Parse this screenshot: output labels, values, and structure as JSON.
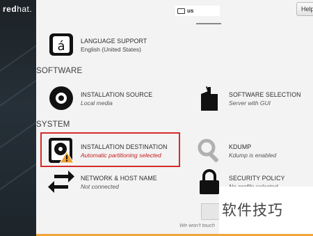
{
  "logo": {
    "text_bold": "red",
    "text_light": "hat."
  },
  "header": {
    "keyboard_layout": "us",
    "help_label": "Help"
  },
  "sections": {
    "software": "SOFTWARE",
    "system": "SYSTEM"
  },
  "spokes": {
    "language_support": {
      "title": "LANGUAGE SUPPORT",
      "status": "English (United States)",
      "icon": "language-icon"
    },
    "installation_source": {
      "title": "INSTALLATION SOURCE",
      "status": "Local media",
      "icon": "disc-icon"
    },
    "software_selection": {
      "title": "SOFTWARE SELECTION",
      "status": "Server with GUI",
      "icon": "package-icon"
    },
    "installation_destination": {
      "title": "INSTALLATION DESTINATION",
      "status": "Automatic partitioning selected",
      "icon": "hard-drive-warning-icon"
    },
    "kdump": {
      "title": "KDUMP",
      "status": "Kdump is enabled",
      "icon": "magnifier-icon"
    },
    "network": {
      "title": "NETWORK & HOST NAME",
      "status": "Not connected",
      "icon": "network-arrows-icon"
    },
    "security_policy": {
      "title": "SECURITY POLICY",
      "status": "No profile selected",
      "icon": "lock-icon"
    }
  },
  "footer_note": "We won't touch",
  "watermark_text": "软件技巧",
  "colors": {
    "warning": "#c61a1a",
    "highlight_border": "#d42a2a",
    "accent_bar": "#f0a63a"
  }
}
